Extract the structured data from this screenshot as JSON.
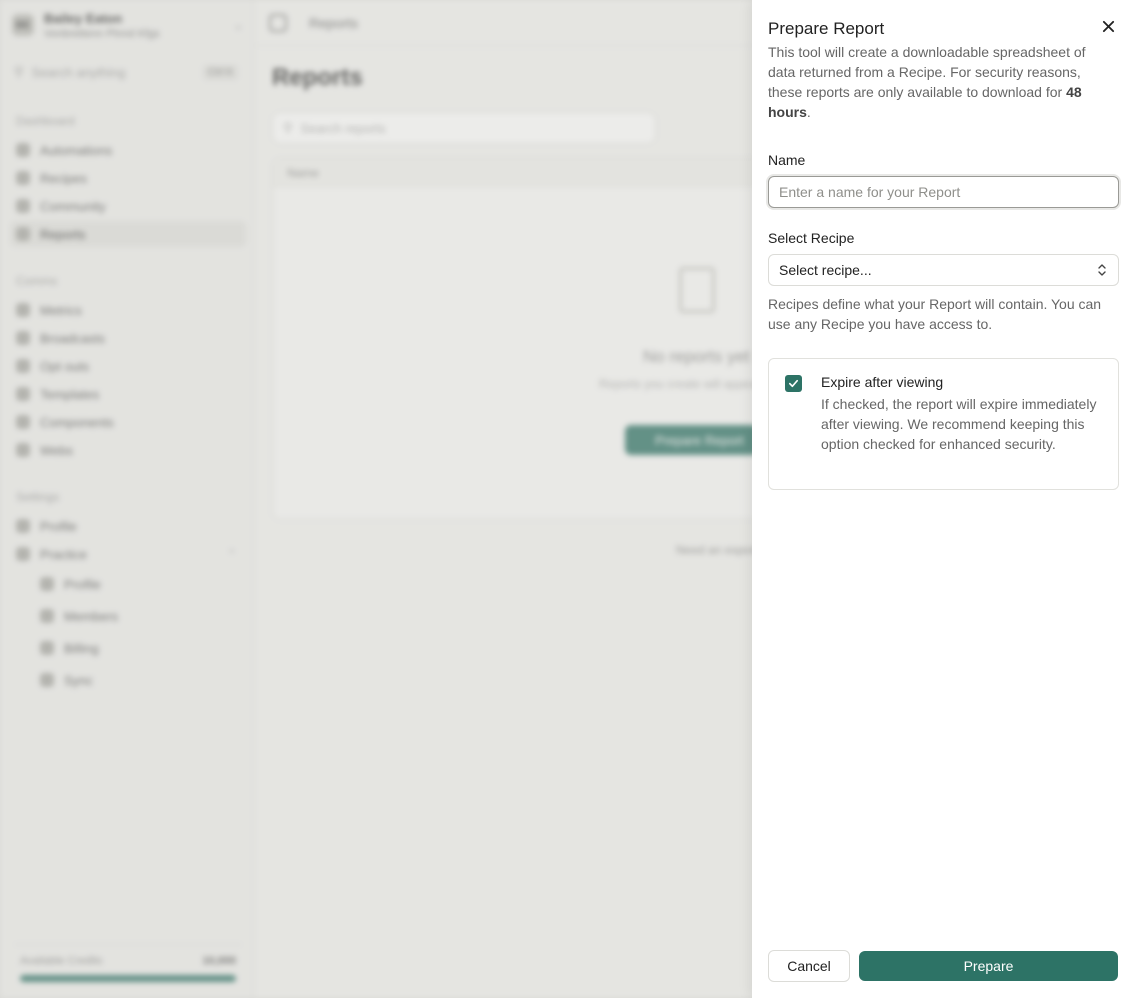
{
  "background": {
    "workspace": {
      "name": "Bailey Eaton",
      "subtitle": "Vonbrettenn Plnnd Kfgs",
      "avatar": "BE"
    },
    "search": {
      "placeholder": "Search anything",
      "shortcut": "Ctrl K"
    },
    "sections": {
      "dashboard": "Dashboard",
      "comms": "Comms",
      "settings": "Settings"
    },
    "nav": {
      "automations": "Automations",
      "recipes": "Recipes",
      "community": "Community",
      "reports": "Reports",
      "metrics": "Metrics",
      "broadcasts": "Broadcasts",
      "opt_outs": "Opt outs",
      "templates": "Templates",
      "components": "Components",
      "webs": "Webs",
      "profile": "Profile",
      "practice": "Practice",
      "profile_sub": "Profile",
      "members": "Members",
      "billing": "Billing",
      "sync": "Sync"
    },
    "credits": {
      "label": "Available Credits",
      "value": "10,000",
      "fill_fraction": 1.0
    },
    "topbar": {
      "crumb": "Reports"
    },
    "page_title": "Reports",
    "report_search_placeholder": "Search reports",
    "table": {
      "column_name": "Name"
    },
    "empty": {
      "title": "No reports yet",
      "subtitle": "Reports you create will appear here",
      "button": "Prepare Report"
    },
    "footer_note": "Need an export?"
  },
  "drawer": {
    "title": "Prepare Report",
    "description_pre": "This tool will create a downloadable spreadsheet of data returned from a Recipe. For security reasons, these reports are only available to download for ",
    "description_bold": "48 hours",
    "description_post": ".",
    "name_label": "Name",
    "name_placeholder": "Enter a name for your Report",
    "name_value": "",
    "recipe_label": "Select Recipe",
    "recipe_selected": "Select recipe...",
    "recipe_help": "Recipes define what your Report will contain. You can use any Recipe you have access to.",
    "expire": {
      "checked": true,
      "title": "Expire after viewing",
      "description": "If checked, the report will expire immediately after viewing. We recommend keeping this option checked for enhanced security."
    },
    "cancel_label": "Cancel",
    "prepare_label": "Prepare",
    "accent_color": "#2d7366"
  }
}
